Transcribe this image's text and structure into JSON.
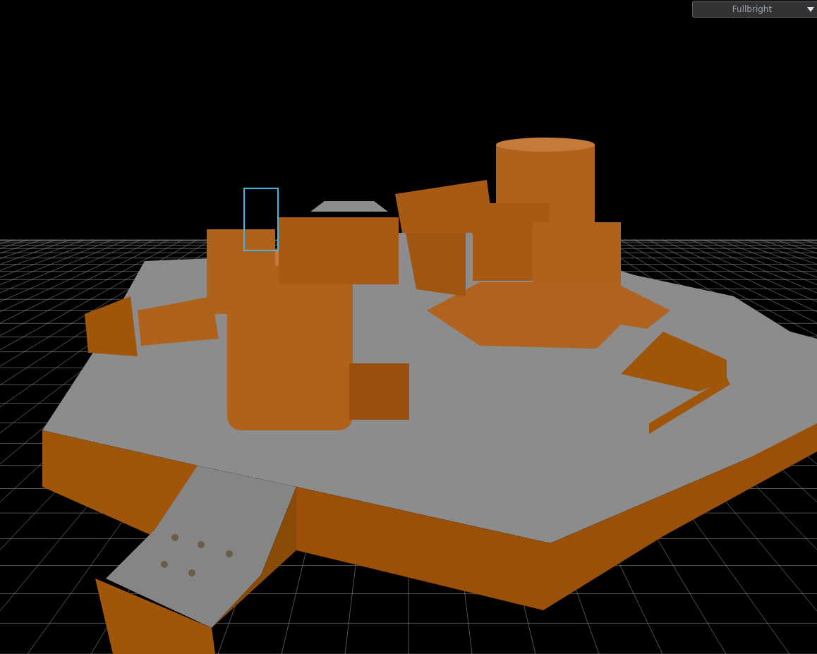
{
  "viewport": {
    "render_mode": {
      "value": "Fullbright"
    }
  }
}
